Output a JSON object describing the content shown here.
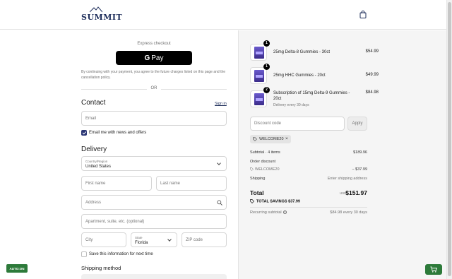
{
  "header": {
    "logo_text": "SUMMIT"
  },
  "express": {
    "label": "Express checkout",
    "gpay_label": "Pay",
    "consent": "By continuing with your payment, you agree to the future charges listed on this page and the cancellation policy.",
    "or_label": "OR"
  },
  "contact": {
    "title": "Contact",
    "signin": "Sign in",
    "email_placeholder": "Email",
    "news_label": "Email me with news and offers"
  },
  "delivery": {
    "title": "Delivery",
    "country_label": "Country/Region",
    "country_value": "United States",
    "first_name": "First name",
    "last_name": "Last name",
    "address": "Address",
    "apartment": "Apartment, suite, etc. (optional)",
    "city": "City",
    "state_label": "State",
    "state_value": "Florida",
    "zip": "ZIP code",
    "save_label": "Save this information for next time",
    "shipping_method_title": "Shipping method"
  },
  "autoon_label": "AUTO:ON",
  "order": {
    "items": [
      {
        "qty": "1",
        "name": "25mg Delta-8 Gummies - 30ct",
        "sub": "",
        "price": "$54.99"
      },
      {
        "qty": "1",
        "name": "25mg HHC Gummies - 20ct",
        "sub": "",
        "price": "$49.99"
      },
      {
        "qty": "2",
        "name": "Subscription of 15mg Delta-9 Gummies - 20ct",
        "sub": "Delivery every 30 days",
        "price": "$84.98"
      }
    ],
    "discount_placeholder": "Discount code",
    "apply_label": "Apply",
    "chip_code": "WELCOME20",
    "subtotal_label": "Subtotal · 4 items",
    "subtotal_value": "$189.96",
    "order_discount_label": "Order discount",
    "discount_code": "WELCOME20",
    "discount_value": "− $37.99",
    "shipping_label": "Shipping",
    "shipping_value": "Enter shipping address",
    "total_label": "Total",
    "currency": "USD",
    "total_value": "$151.97",
    "savings_label": "TOTAL SAVINGS",
    "savings_value": "$37.99",
    "recurring_label": "Recurring subtotal",
    "recurring_value": "$84.98 every 30 days"
  },
  "colors": {
    "brand": "#1d2d5a",
    "checkbox": "#2a3574",
    "green": "#2d7a3a"
  }
}
